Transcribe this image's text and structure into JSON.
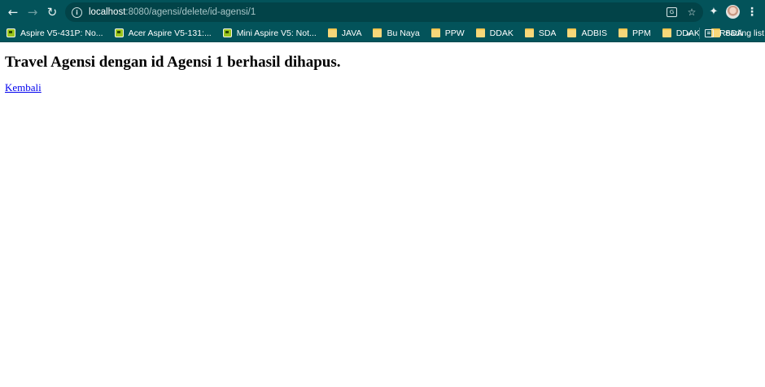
{
  "browser": {
    "url_host": "localhost",
    "url_path": ":8080/agensi/delete/id-agensi/1",
    "bookmarks": [
      {
        "label": "Aspire V5-431P: No...",
        "icon": "laptop-favicon"
      },
      {
        "label": "Acer Aspire V5-131:...",
        "icon": "laptop-favicon"
      },
      {
        "label": "Mini Aspire V5: Not...",
        "icon": "laptop-favicon"
      },
      {
        "label": "JAVA",
        "icon": "folder-icon"
      },
      {
        "label": "Bu Naya",
        "icon": "folder-icon"
      },
      {
        "label": "PPW",
        "icon": "folder-icon"
      },
      {
        "label": "DDAK",
        "icon": "folder-icon"
      },
      {
        "label": "SDA",
        "icon": "folder-icon"
      },
      {
        "label": "ADBIS",
        "icon": "folder-icon"
      },
      {
        "label": "PPM",
        "icon": "folder-icon"
      },
      {
        "label": "DDAK",
        "icon": "folder-icon"
      },
      {
        "label": "SDA",
        "icon": "folder-icon"
      }
    ],
    "overflow_label": "»",
    "reading_list_label": "Reading list",
    "colors": {
      "toolbar": "#03535a",
      "omnibox": "#024348"
    }
  },
  "page": {
    "heading": "Travel Agensi dengan id Agensi 1 berhasil dihapus.",
    "back_link": "Kembali"
  }
}
